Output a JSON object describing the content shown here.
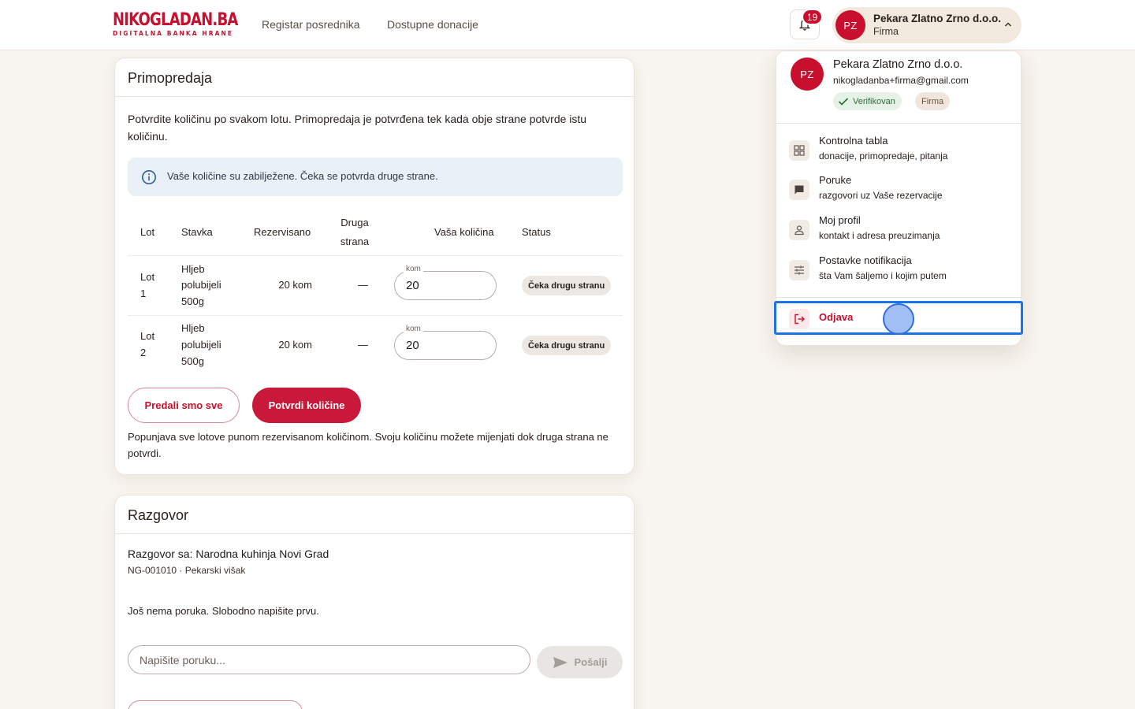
{
  "header": {
    "logo_main": "NIKOGLADAN.BA",
    "logo_sub": "DIGITALNA BANKA HRANE",
    "nav": [
      {
        "label": "Registar posrednika"
      },
      {
        "label": "Dostupne donacije"
      }
    ],
    "notifications_count": "19",
    "user": {
      "initials": "PZ",
      "name": "Pekara Zlatno Zrno d.o.o.",
      "role": "Firma"
    }
  },
  "handover": {
    "title": "Primopredaja",
    "intro": "Potvrdite količinu po svakom lotu. Primopredaja je potvrđena tek kada obje strane potvrde istu količinu.",
    "info": "Vaše količine su zabilježene. Čeka se potvrda druge strane.",
    "columns": {
      "lot": "Lot",
      "item": "Stavka",
      "reserved": "Rezervisano",
      "other_1": "Druga",
      "other_2": "strana",
      "yours": "Vaša količina",
      "status": "Status"
    },
    "rows": [
      {
        "lot_1": "Lot",
        "lot_2": "1",
        "item_1": "Hljeb",
        "item_2": "polubijeli",
        "item_3": "500g",
        "reserved": "20 kom",
        "other": "—",
        "qty_label": "kom",
        "qty": "20",
        "status": "Čeka drugu stranu"
      },
      {
        "lot_1": "Lot",
        "lot_2": "2",
        "item_1": "Hljeb",
        "item_2": "polubijeli",
        "item_3": "500g",
        "reserved": "20 kom",
        "other": "—",
        "qty_label": "kom",
        "qty": "20",
        "status": "Čeka drugu stranu"
      }
    ],
    "btn_all": "Predali smo sve",
    "btn_confirm": "Potvrdi količine",
    "footnote": "Popunjava sve lotove punom rezervisanom količinom. Svoju količinu možete mijenjati dok druga strana ne potvrdi."
  },
  "conversation": {
    "title": "Razgovor",
    "with": "Razgovor sa: Narodna kuhinja Novi Grad",
    "id_line": "NG-001010 · Pekarski višak",
    "empty": "Još nema poruka. Slobodno napišite prvu.",
    "input_placeholder": "Napišite poruku...",
    "send": "Pošalji"
  },
  "menu": {
    "initials": "PZ",
    "name": "Pekara Zlatno Zrno d.o.o.",
    "email": "nikogladanba+firma@gmail.com",
    "tag_verified": "Verifikovan",
    "tag_type": "Firma",
    "items": [
      {
        "title": "Kontrolna tabla",
        "sub": "donacije, primopredaje, pitanja",
        "icon": "dashboard-icon"
      },
      {
        "title": "Poruke",
        "sub": "razgovori uz Vaše rezervacije",
        "icon": "chat-icon"
      },
      {
        "title": "Moj profil",
        "sub": "kontakt i adresa preuzimanja",
        "icon": "person-icon"
      },
      {
        "title": "Postavke notifikacija",
        "sub": "šta Vam šaljemo i kojim putem",
        "icon": "tune-icon"
      }
    ],
    "logout": "Odjava"
  },
  "colors": {
    "brand": "#c8102e",
    "background": "#f8f4ef",
    "highlight": "#1a73e8"
  }
}
